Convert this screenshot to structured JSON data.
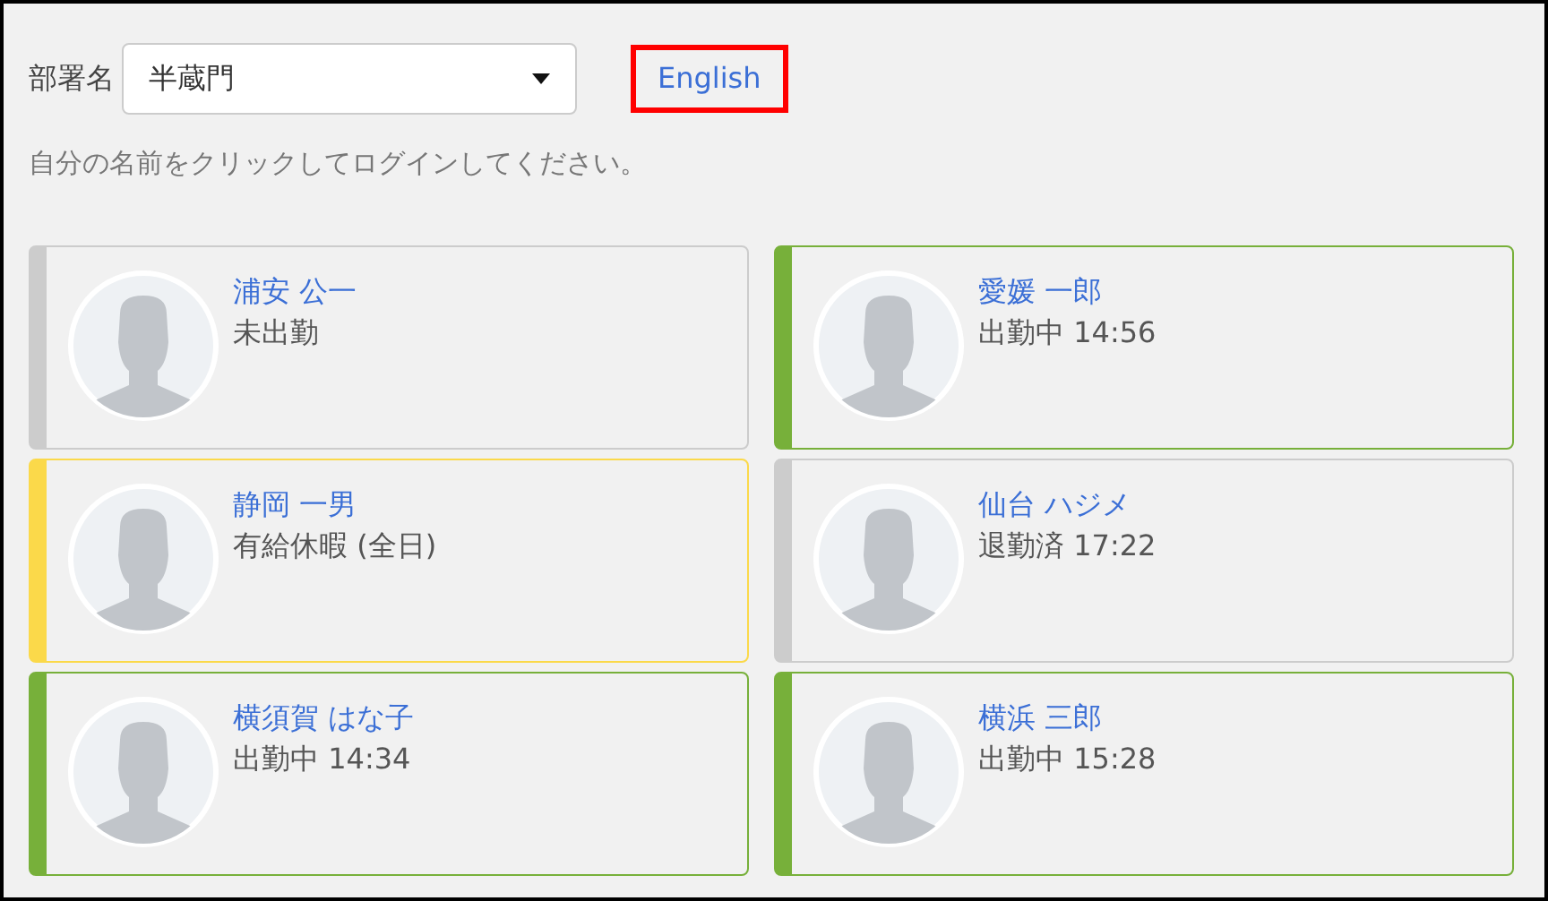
{
  "department": {
    "label": "部署名",
    "value": "半蔵門"
  },
  "language_link": {
    "label": "English",
    "highlighted": true
  },
  "instruction": "自分の名前をクリックしてログインしてください。",
  "employees": [
    {
      "name": "浦安 公一",
      "status": "未出勤",
      "color": "#cccccc"
    },
    {
      "name": "愛媛 一郎",
      "status": "出勤中 14:56",
      "color": "#77b03a"
    },
    {
      "name": "静岡 一男",
      "status": "有給休暇 (全日)",
      "color": "#fbd94a"
    },
    {
      "name": "仙台 ハジメ",
      "status": "退勤済 17:22",
      "color": "#cccccc"
    },
    {
      "name": "横須賀 はな子",
      "status": "出勤中 14:34",
      "color": "#77b03a"
    },
    {
      "name": "横浜 三郎",
      "status": "出勤中 15:28",
      "color": "#77b03a"
    }
  ]
}
